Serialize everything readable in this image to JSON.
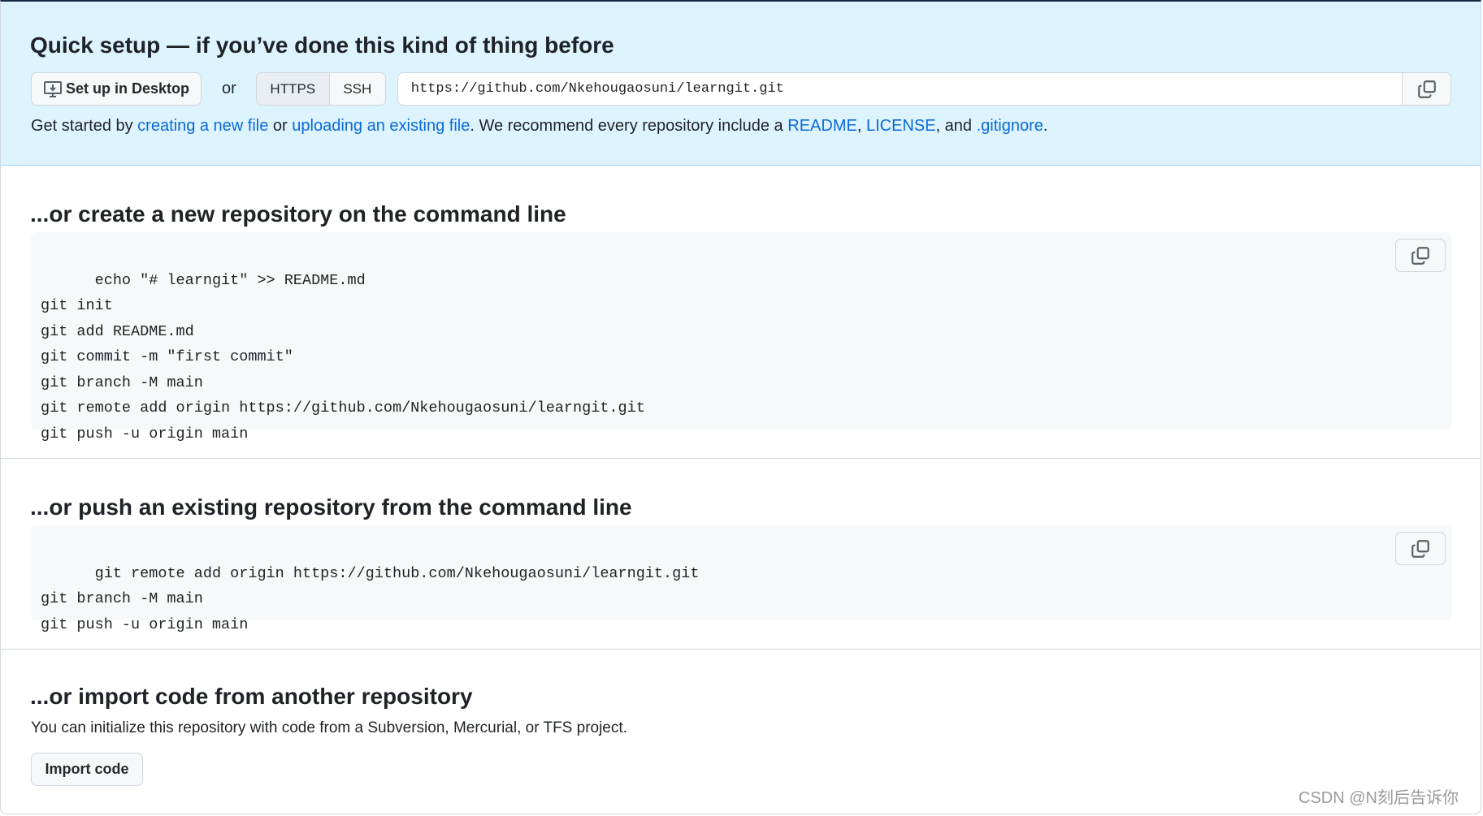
{
  "quick": {
    "title": "Quick setup — if you’ve done this kind of thing before",
    "desktop_label": "Set up in Desktop",
    "or": "or",
    "https": "HTTPS",
    "ssh": "SSH",
    "url": "https://github.com/Nkehougaosuni/learngit.git",
    "help": {
      "t1": "Get started by ",
      "l1": "creating a new file",
      "t2": " or ",
      "l2": "uploading an existing file",
      "t3": ". We recommend every repository include a ",
      "l3": "README",
      "t4": ", ",
      "l4": "LICENSE",
      "t5": ", and ",
      "l5": ".gitignore",
      "t6": "."
    }
  },
  "create": {
    "title": "...or create a new repository on the command line",
    "code": "echo \"# learngit\" >> README.md\ngit init\ngit add README.md\ngit commit -m \"first commit\"\ngit branch -M main\ngit remote add origin https://github.com/Nkehougaosuni/learngit.git\ngit push -u origin main"
  },
  "push": {
    "title": "...or push an existing repository from the command line",
    "code": "git remote add origin https://github.com/Nkehougaosuni/learngit.git\ngit branch -M main\ngit push -u origin main"
  },
  "import": {
    "title": "...or import code from another repository",
    "desc": "You can initialize this repository with code from a Subversion, Mercurial, or TFS project.",
    "button": "Import code"
  },
  "watermark": "CSDN @N刻后告诉你",
  "colors": {
    "link": "#0969da",
    "quick_bg": "#ddf4ff"
  }
}
